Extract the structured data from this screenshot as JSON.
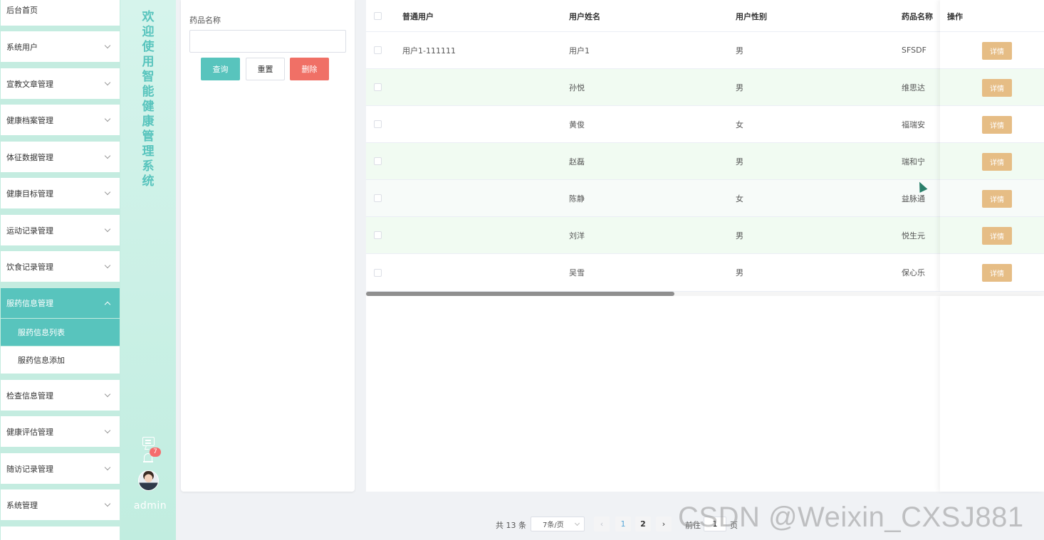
{
  "app": {
    "title_vertical": "欢\n迎\n使\n用\n智\n能\n健\n康\n管\n理\n系\n统",
    "admin_name": "admin",
    "notification_count": "7",
    "accent_color": "#58c4bd",
    "watermark": "CSDN @Weixin_CXSJ881"
  },
  "sidebar": {
    "items": [
      {
        "label": "后台首页"
      },
      {
        "label": "系统用户"
      },
      {
        "label": "宣教文章管理"
      },
      {
        "label": "健康档案管理"
      },
      {
        "label": "体征数据管理"
      },
      {
        "label": "健康目标管理"
      },
      {
        "label": "运动记录管理"
      },
      {
        "label": "饮食记录管理"
      },
      {
        "label": "服药信息管理"
      },
      {
        "label": "检查信息管理"
      },
      {
        "label": "健康评估管理"
      },
      {
        "label": "随访记录管理"
      },
      {
        "label": "系统管理"
      }
    ],
    "submenu": [
      {
        "label": "服药信息列表"
      },
      {
        "label": "服药信息添加"
      }
    ]
  },
  "search": {
    "label": "药品名称",
    "value": "",
    "query_label": "查询",
    "reset_label": "重置",
    "delete_label": "删除"
  },
  "table": {
    "headers": {
      "user": "普通用户",
      "name": "用户姓名",
      "gender": "用户性别",
      "drug": "药品名称",
      "ops": "操作"
    },
    "detail_label": "详情",
    "rows": [
      {
        "user": "用户1-111111",
        "name": "用户1",
        "gender": "男",
        "drug": "SFSDF"
      },
      {
        "user": "",
        "name": "孙悦",
        "gender": "男",
        "drug": "维思达"
      },
      {
        "user": "",
        "name": "黄俊",
        "gender": "女",
        "drug": "福瑞安"
      },
      {
        "user": "",
        "name": "赵磊",
        "gender": "男",
        "drug": "瑞和宁"
      },
      {
        "user": "",
        "name": "陈静",
        "gender": "女",
        "drug": "益脉通"
      },
      {
        "user": "",
        "name": "刘洋",
        "gender": "男",
        "drug": "悦生元"
      },
      {
        "user": "",
        "name": "吴雪",
        "gender": "男",
        "drug": "保心乐"
      }
    ]
  },
  "pagination": {
    "total": "共 13 条",
    "page_size": "7条/页",
    "pages": [
      "1",
      "2"
    ],
    "goto_label": "前往",
    "goto_value": "1",
    "page_suffix": "页"
  }
}
